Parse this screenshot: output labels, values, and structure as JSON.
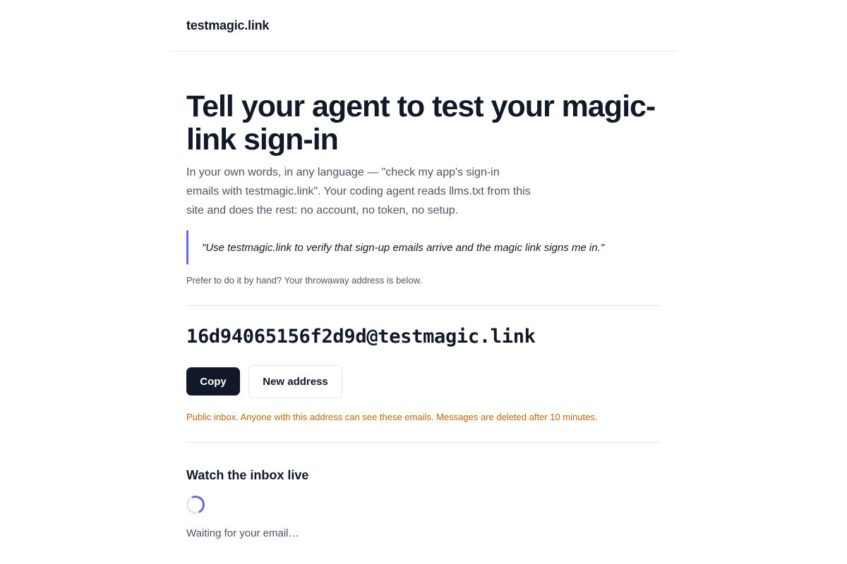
{
  "header": {
    "logo": "testmagic.link"
  },
  "hero": {
    "title": "Tell your agent to test your magic-link sign-in",
    "description": "In your own words, in any language — \"check my app's sign-in emails with testmagic.link\". Your coding agent reads llms.txt from this site and does the rest: no account, no token, no setup.",
    "quote": "\"Use testmagic.link to verify that sign-up emails arrive and the magic link signs me in.\"",
    "hand_note": "Prefer to do it by hand? Your throwaway address is below."
  },
  "address": {
    "value": "16d94065156f2d9d@testmagic.link",
    "copy_label": "Copy",
    "new_label": "New address",
    "warning": "Public inbox. Anyone with this address can see these emails. Messages are deleted after 10 minutes."
  },
  "inbox": {
    "title": "Watch the inbox live",
    "status": "Waiting for your email…"
  },
  "colors": {
    "accent": "#6366f1",
    "warning": "#c2650c",
    "primary_button": "#111827"
  },
  "icons": {
    "spinner": "loading-spinner-icon"
  }
}
